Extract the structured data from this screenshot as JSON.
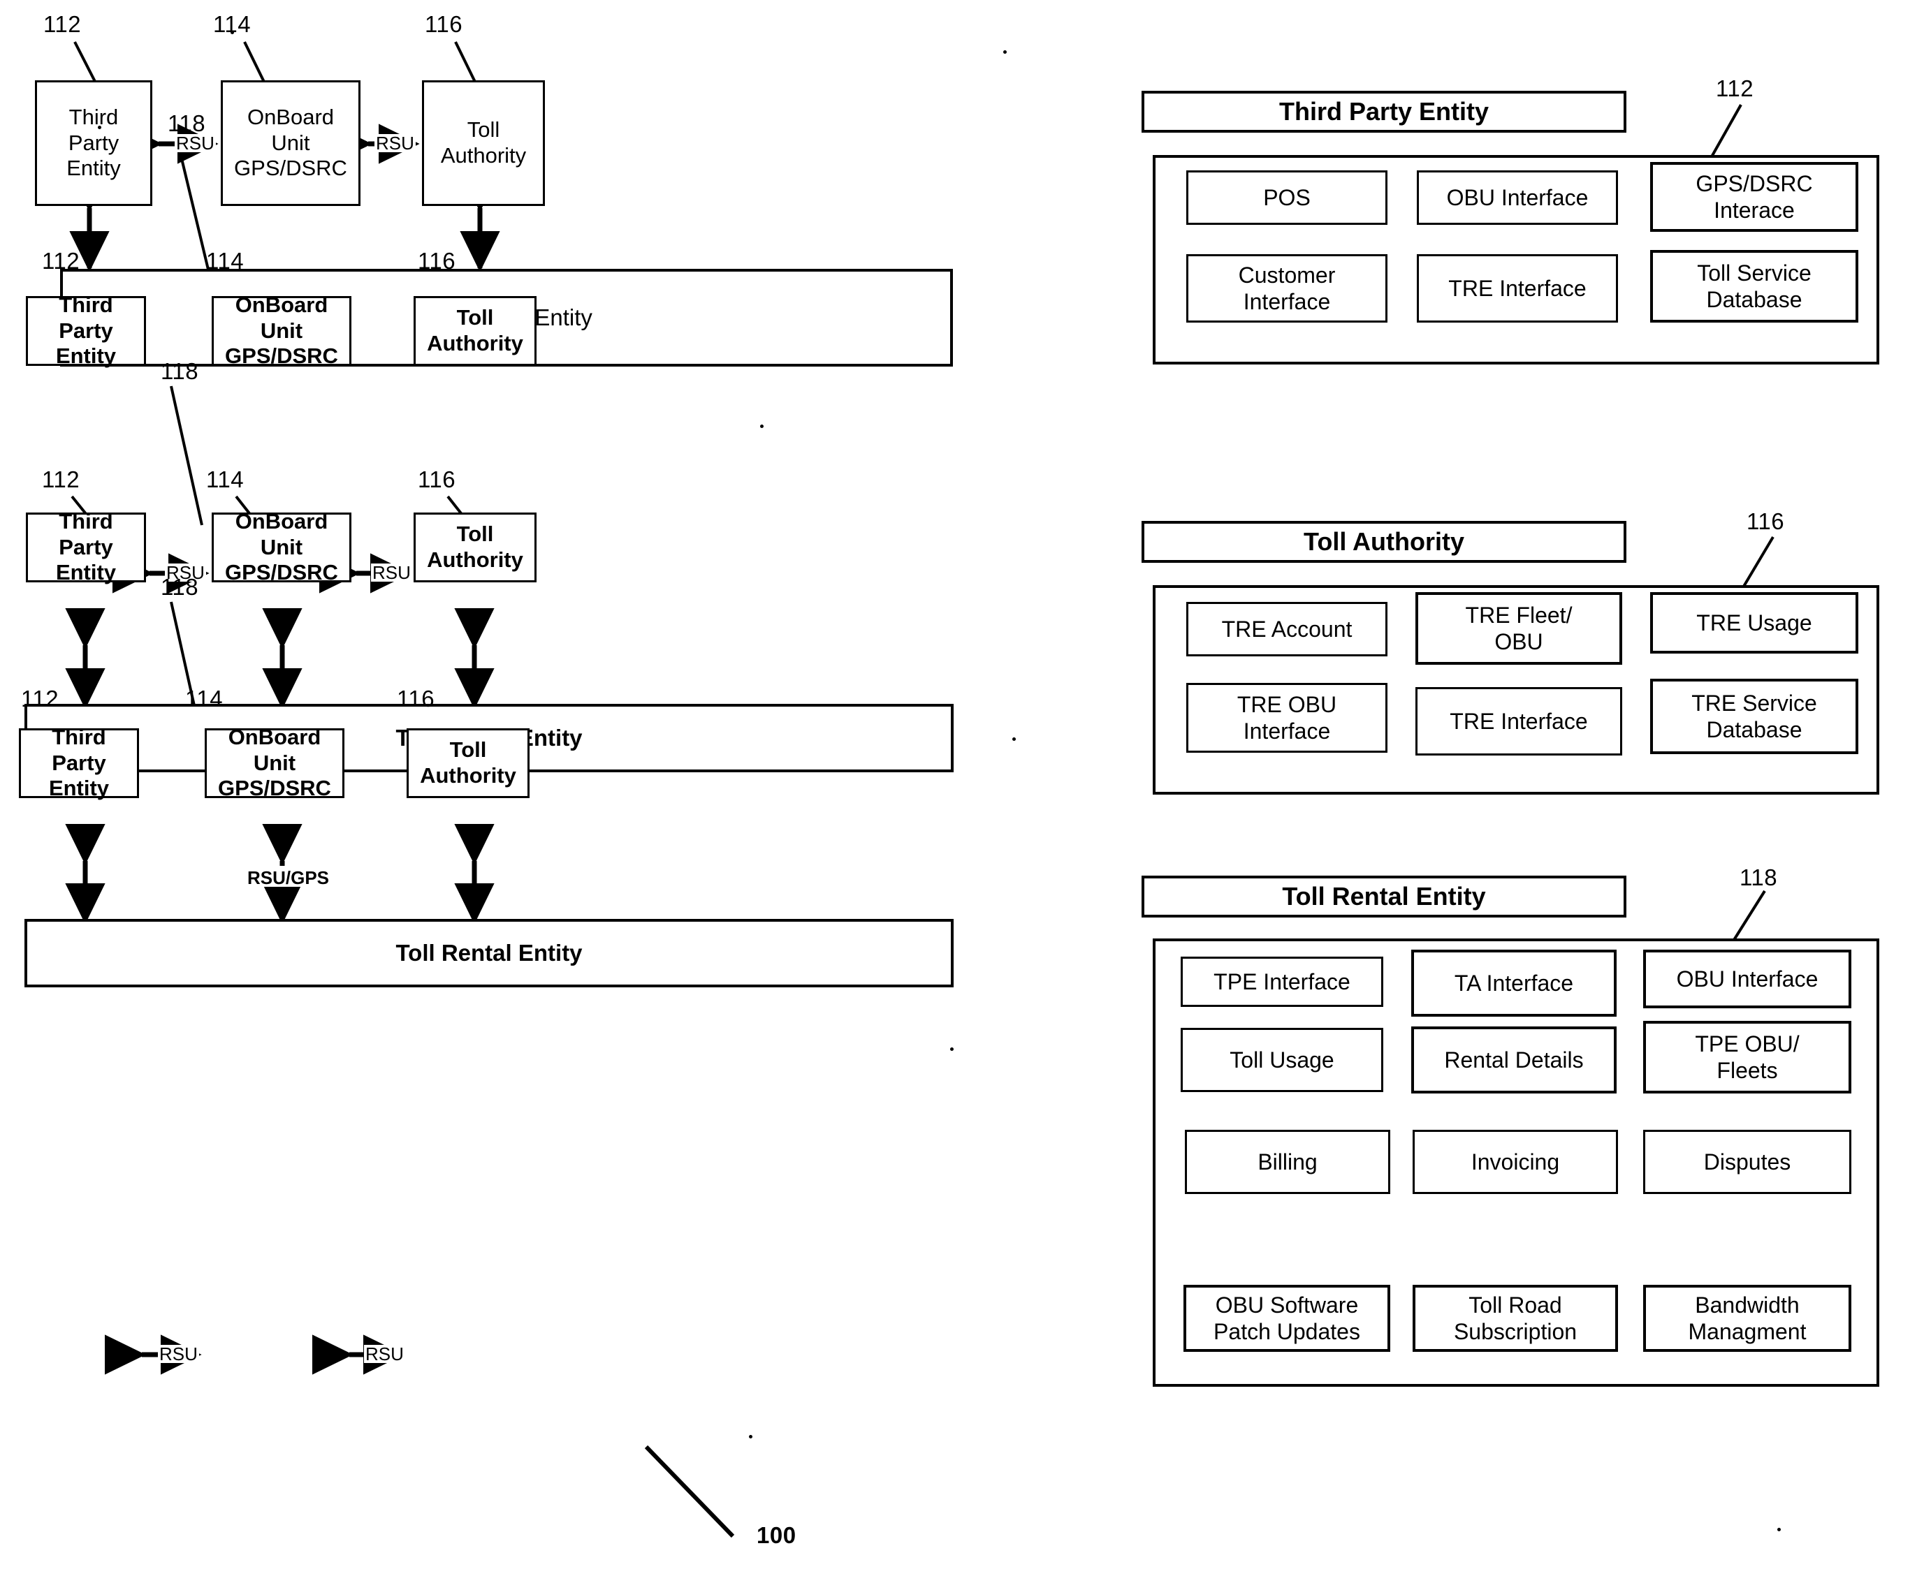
{
  "figure": {
    "reference_numeral": "100",
    "entity_labels": {
      "tpe": "112",
      "obu": "114",
      "ta": "116",
      "tre": "118"
    }
  },
  "boxes": {
    "third_party_entity": "Third Party\nEntity",
    "third_party_entity_line1": "Third Party",
    "third_party_entity_line2": "Entity",
    "onboard_unit_line1": "OnBoard Unit",
    "onboard_unit_line2": "GPS/DSRC",
    "toll_authority_line1": "Toll",
    "toll_authority_line2": "Authority",
    "toll_rental_entity": "Toll Rental Entity"
  },
  "connectors": {
    "rsu": "RSU",
    "rsu_gps": "RSU/GPS"
  },
  "diagrams": [
    {
      "id": "diagram-1",
      "bold": false,
      "refs": [
        "112",
        "114",
        "116",
        "118"
      ],
      "links": [
        "RSU",
        "RSU"
      ],
      "obu_to_tre": false
    },
    {
      "id": "diagram-2",
      "bold": true,
      "refs": [
        "112",
        "114",
        "116",
        "118"
      ],
      "links": [
        "RSU",
        "RSU"
      ],
      "obu_to_tre": true
    },
    {
      "id": "diagram-3",
      "bold": true,
      "refs": [
        "112",
        "114",
        "116",
        "118"
      ],
      "links": [
        "RSU/GPS"
      ],
      "obu_to_tre": true
    },
    {
      "id": "diagram-4",
      "bold": true,
      "refs": [
        "112",
        "114",
        "116"
      ],
      "links": [
        "RSU",
        "RSU"
      ],
      "obu_to_tre": false
    }
  ],
  "panels": [
    {
      "id": "third-party-entity-panel",
      "title": "Third Party Entity",
      "reference_numeral": "112",
      "rows": [
        [
          "POS",
          "OBU Interface",
          "GPS/DSRC\nInterace"
        ],
        [
          "Customer\nInterface",
          "TRE Interface",
          "Toll Service\nDatabase"
        ]
      ],
      "cells": [
        {
          "label": "POS"
        },
        {
          "label": "OBU Interface"
        },
        {
          "label": "GPS/DSRC Interace",
          "line1": "GPS/DSRC",
          "line2": "Interace"
        },
        {
          "label": "Customer Interface",
          "line1": "Customer",
          "line2": "Interface"
        },
        {
          "label": "TRE Interface"
        },
        {
          "label": "Toll Service Database",
          "line1": "Toll Service",
          "line2": "Database"
        }
      ]
    },
    {
      "id": "toll-authority-panel",
      "title": "Toll Authority",
      "reference_numeral": "116",
      "cells": [
        {
          "label": "TRE Account"
        },
        {
          "label": "TRE Fleet/ OBU",
          "line1": "TRE Fleet/",
          "line2": "OBU"
        },
        {
          "label": "TRE Usage"
        },
        {
          "label": "TRE OBU Interface",
          "line1": "TRE OBU",
          "line2": "Interface"
        },
        {
          "label": "TRE Interface"
        },
        {
          "label": "TRE Service Database",
          "line1": "TRE Service",
          "line2": "Database"
        }
      ]
    },
    {
      "id": "toll-rental-entity-panel",
      "title": "Toll Rental Entity",
      "reference_numeral": "118",
      "cells": [
        {
          "label": "TPE Interface"
        },
        {
          "label": "TA Interface"
        },
        {
          "label": "OBU Interface"
        },
        {
          "label": "Toll Usage"
        },
        {
          "label": "Rental Details"
        },
        {
          "label": "TPE OBU/ Fleets",
          "line1": "TPE OBU/",
          "line2": "Fleets"
        },
        {
          "label": "Billing"
        },
        {
          "label": "Invoicing"
        },
        {
          "label": "Disputes"
        },
        {
          "label": "OBU Software Patch Updates",
          "line1": "OBU Software",
          "line2": "Patch Updates"
        },
        {
          "label": "Toll Road Subscription",
          "line1": "Toll Road",
          "line2": "Subscription"
        },
        {
          "label": "Bandwidth Managment",
          "line1": "Bandwidth",
          "line2": "Managment"
        }
      ]
    }
  ],
  "colors": {
    "ink": "#000000",
    "paper": "#ffffff"
  }
}
